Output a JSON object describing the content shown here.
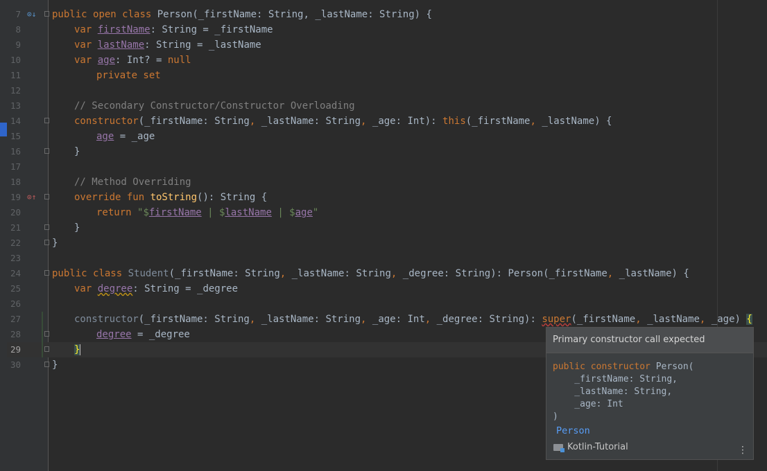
{
  "editor": {
    "lines": [
      {
        "num": "7",
        "html_key": "l7"
      },
      {
        "num": "8"
      },
      {
        "num": "9"
      },
      {
        "num": "10"
      },
      {
        "num": "11"
      },
      {
        "num": "12"
      },
      {
        "num": "13"
      },
      {
        "num": "14"
      },
      {
        "num": "15"
      },
      {
        "num": "16"
      },
      {
        "num": "17"
      },
      {
        "num": "18"
      },
      {
        "num": "19"
      },
      {
        "num": "20"
      },
      {
        "num": "21"
      },
      {
        "num": "22"
      },
      {
        "num": "23"
      },
      {
        "num": "24"
      },
      {
        "num": "25"
      },
      {
        "num": "26"
      },
      {
        "num": "27"
      },
      {
        "num": "28"
      },
      {
        "num": "29"
      },
      {
        "num": "30"
      }
    ],
    "code": {
      "l7": [
        "public ",
        "open ",
        "class ",
        "Person",
        "(_firstName: String, _lastName: String) {"
      ],
      "l8": [
        "var ",
        "firstName",
        ": String = _firstName"
      ],
      "l9": [
        "var ",
        "lastName",
        ": String = _lastName"
      ],
      "l10": [
        "var ",
        "age",
        ": Int? = ",
        "null"
      ],
      "l11": [
        "private set"
      ],
      "l13": [
        "// Secondary Constructor/Constructor Overloading"
      ],
      "l14": [
        "constructor",
        "(_firstName: String",
        ", ",
        "_lastName: String",
        ", ",
        "_age: Int): ",
        "this",
        "(_firstName",
        ", ",
        "_lastName) {"
      ],
      "l15": [
        "age",
        " = _age"
      ],
      "l16": [
        "}"
      ],
      "l18": [
        "// Method Overriding"
      ],
      "l19": [
        "override ",
        "fun ",
        "toString",
        "(): String {"
      ],
      "l20": [
        "return ",
        "\"$",
        "firstName",
        " | $",
        "lastName",
        " | $",
        "age",
        "\""
      ],
      "l21": [
        "}"
      ],
      "l22": [
        "}"
      ],
      "l24": [
        "public ",
        "class ",
        "Student",
        "(_firstName: String",
        ", ",
        "_lastName: String",
        ", ",
        "_degree: String): Person(_firstName",
        ", ",
        "_lastName) {"
      ],
      "l25": [
        "var ",
        "degree",
        ": String = _degree"
      ],
      "l27": [
        "constructor",
        "(_firstName: String",
        ", ",
        "_lastName: String",
        ", ",
        "_age: Int",
        ", ",
        "_degree: String): ",
        "super",
        "(_firstName",
        ", ",
        "_lastName",
        ", ",
        "_age) ",
        "{"
      ],
      "l28": [
        "degree",
        " = _degree"
      ],
      "l29": [
        "}"
      ],
      "l30": [
        "}"
      ]
    }
  },
  "popup": {
    "header": "Primary constructor call expected",
    "signature_lines": [
      "public constructor Person(",
      "    _firstName: String,",
      "    _lastName: String,",
      "    _age: Int",
      ")"
    ],
    "link": "Person",
    "module": "Kotlin-Tutorial",
    "more_icon": "more-vertical-icon"
  },
  "colors": {
    "background": "#2b2b2b",
    "keyword": "#cc7832",
    "property": "#9876aa",
    "string": "#6a8759",
    "comment": "#808080",
    "function": "#ffc66d",
    "link": "#589df6"
  }
}
